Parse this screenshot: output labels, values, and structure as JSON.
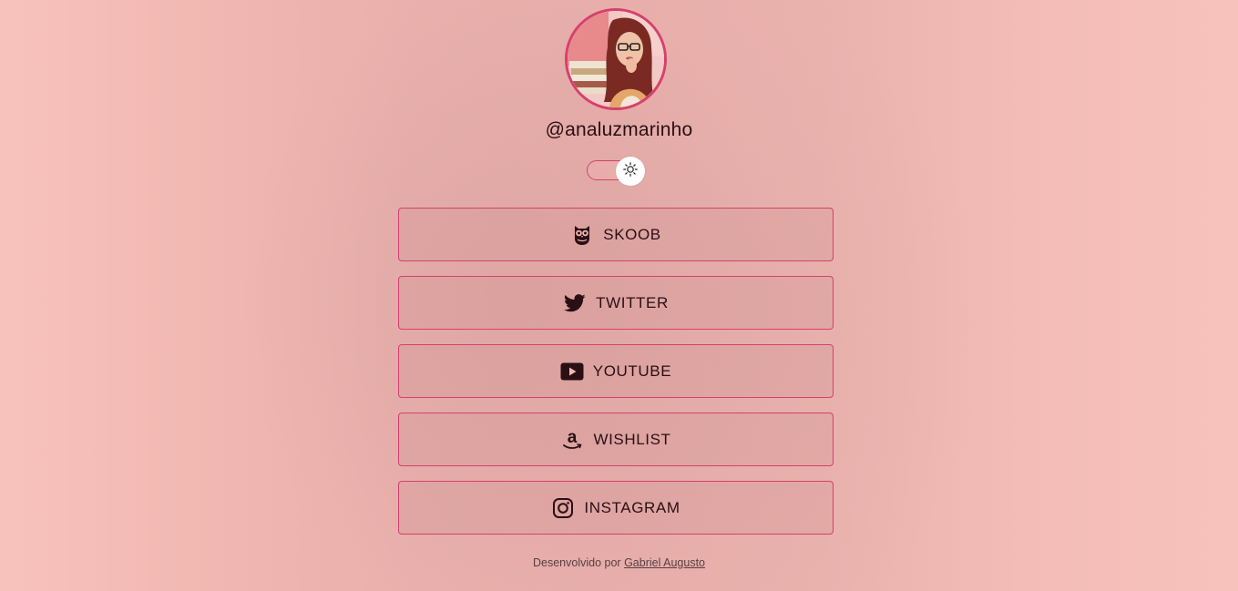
{
  "profile": {
    "username": "@analuzmarinho",
    "avatar_alt": "avatar"
  },
  "theme_toggle": {
    "icon": "sun-icon"
  },
  "links": [
    {
      "label": "SKOOB",
      "icon": "owl-icon"
    },
    {
      "label": "TWITTER",
      "icon": "twitter-bird-icon"
    },
    {
      "label": "YOUTUBE",
      "icon": "youtube-play-icon"
    },
    {
      "label": "WISHLIST",
      "icon": "amazon-icon"
    },
    {
      "label": "INSTAGRAM",
      "icon": "instagram-icon"
    }
  ],
  "footer": {
    "prefix": "Desenvolvido por",
    "author": "Gabriel Augusto"
  },
  "colors": {
    "background": "#f8c2bc",
    "accent": "#d6406e",
    "text": "#2a0f14"
  }
}
